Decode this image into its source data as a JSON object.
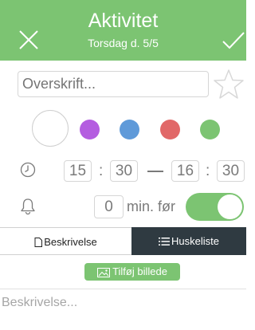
{
  "header": {
    "title": "Aktivitet",
    "subtitle": "Torsdag d. 5/5",
    "close_icon": "close-icon",
    "confirm_icon": "check-icon",
    "background": "#7cc472"
  },
  "title_field": {
    "placeholder": "Overskrift...",
    "value": ""
  },
  "favorite_icon": "star-icon",
  "colors": {
    "options": [
      "#ffffff",
      "#b45de0",
      "#5f9ad9",
      "#e16868",
      "#7cc472"
    ],
    "selected": "#ffffff"
  },
  "time": {
    "start_hour": "15",
    "start_minute": "30",
    "end_hour": "16",
    "end_minute": "30",
    "separator": ":"
  },
  "reminder": {
    "minutes": "0",
    "label": "min. før",
    "enabled": true
  },
  "tabs": [
    {
      "label": "Beskrivelse",
      "icon": "document-icon",
      "active": false
    },
    {
      "label": "Huskeliste",
      "icon": "list-icon",
      "active": true
    }
  ],
  "add_image_label": "Tilføj billede",
  "description": {
    "placeholder": "Beskrivelse..."
  }
}
